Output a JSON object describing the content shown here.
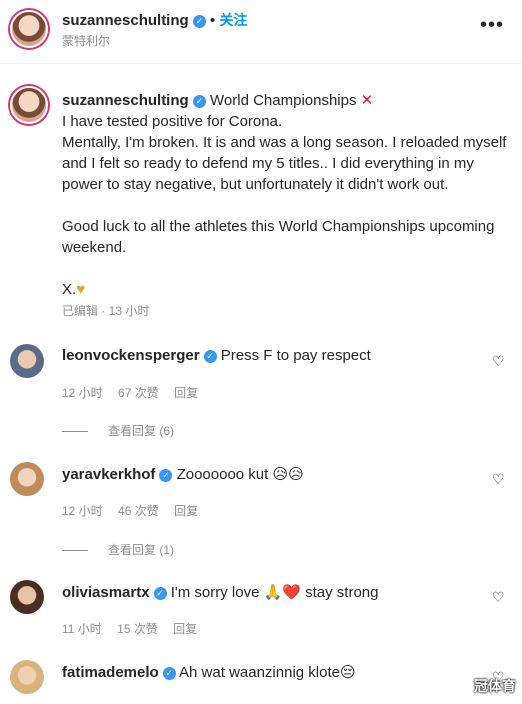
{
  "header": {
    "username": "suzanneschulting",
    "follow_label": "关注",
    "location": "蒙特利尔",
    "more_icon": "more-horizontal-icon"
  },
  "caption": {
    "username": "suzanneschulting",
    "title": "World Championships",
    "lines": [
      "I have tested positive for Corona.",
      "Mentally, I'm broken. It is and was a long season. I reloaded myself and I felt so ready to defend my 5 titles.. I did everything in my power to stay negative, but unfortunately it didn't work out.",
      "Good luck to all the athletes this World Championships upcoming weekend.",
      "X."
    ],
    "meta": "已编辑 · 13 小时"
  },
  "comments": [
    {
      "username": "leonvockensperger",
      "text": "Press F to pay respect",
      "time": "12 小时",
      "likes": "67 次赞",
      "reply_label": "回复",
      "view_replies": "查看回复 (6)"
    },
    {
      "username": "yaravkerkhof",
      "text": "Zooooooo kut 😥😥",
      "time": "12 小时",
      "likes": "46 次赞",
      "reply_label": "回复",
      "view_replies": "查看回复 (1)"
    },
    {
      "username": "oliviasmartx",
      "text": "I'm sorry love 🙏❤️ stay strong",
      "time": "11 小时",
      "likes": "15 次赞",
      "reply_label": "回复"
    },
    {
      "username": "fatimademelo",
      "text": "Ah wat waanzinnig klote😔"
    }
  ],
  "watermark": "冠体育",
  "colors": {
    "accent": "#0095f6",
    "verified": "#3897f0",
    "muted": "#8e8e8e"
  }
}
